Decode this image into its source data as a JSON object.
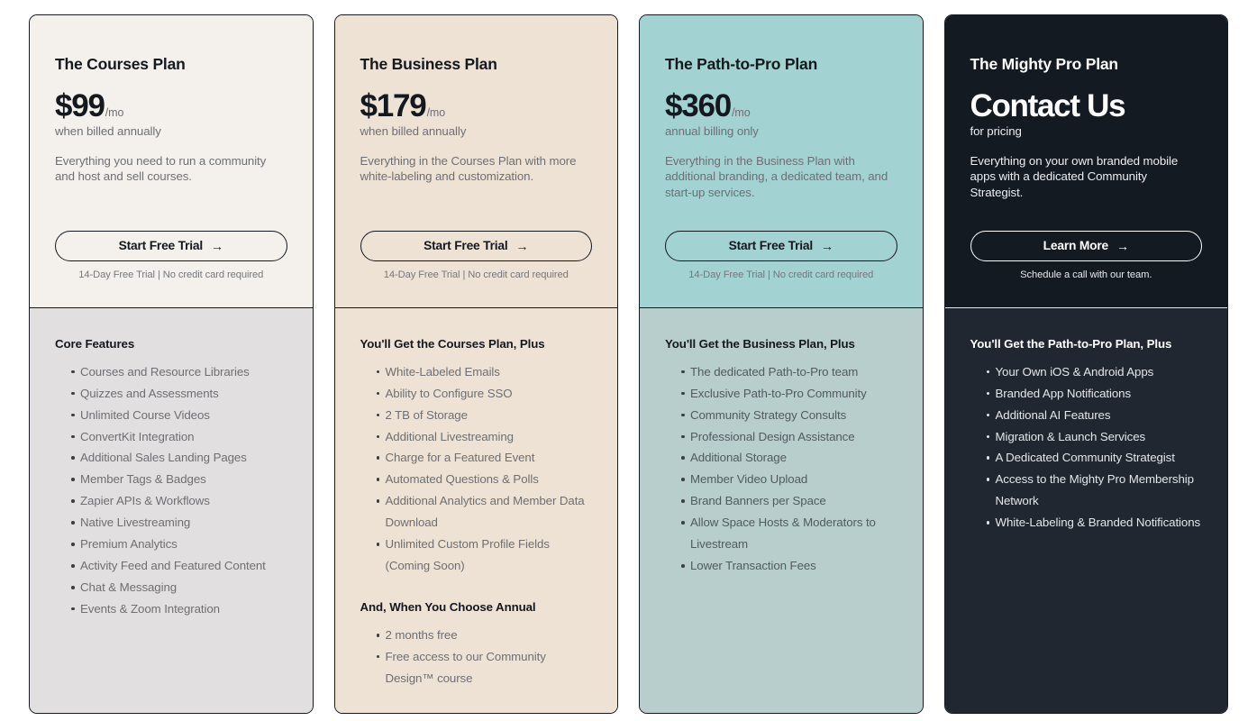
{
  "page": {
    "background": "#ffffff",
    "accent_teal": "#a2d2d2",
    "accent_cream": "#eee2d5",
    "accent_dark": "#141a22"
  },
  "plans": [
    {
      "name": "The Courses Plan",
      "price": "$99",
      "price_suffix": "/mo",
      "price_note": "when billed annually",
      "description": "Everything you need to run a community and host and sell courses.",
      "cta_label": "Start Free Trial",
      "cta_arrow": "→",
      "cta_sub": "14-Day Free Trial | No credit card required",
      "groups": [
        {
          "title": "Core Features",
          "items": [
            "Courses and Resource Libraries",
            "Quizzes and Assessments",
            "Unlimited Course Videos",
            "ConvertKit Integration",
            "Additional Sales Landing Pages",
            "Member Tags & Badges",
            "Zapier APIs & Workflows",
            "Native Livestreaming",
            "Premium Analytics",
            "Activity Feed and Featured Content",
            "Chat & Messaging",
            "Events & Zoom Integration"
          ]
        }
      ]
    },
    {
      "name": "The Business Plan",
      "price": "$179",
      "price_suffix": "/mo",
      "price_note": "when billed annually",
      "description": "Everything in the Courses Plan with more white-labeling and customization.",
      "cta_label": "Start Free Trial",
      "cta_arrow": "→",
      "cta_sub": "14-Day Free Trial | No credit card required",
      "groups": [
        {
          "title": "You'll Get the Courses Plan, Plus",
          "items": [
            "White-Labeled Emails",
            "Ability to Configure SSO",
            "2 TB of Storage",
            "Additional Livestreaming",
            "Charge for a Featured Event",
            "Automated Questions & Polls",
            "Additional Analytics and Member Data Download",
            "Unlimited Custom Profile Fields (Coming Soon)"
          ]
        },
        {
          "title": "And, When You Choose Annual",
          "items": [
            "2 months free",
            "Free access to our Community Design™ course"
          ]
        }
      ]
    },
    {
      "name": "The Path-to-Pro Plan",
      "price": "$360",
      "price_suffix": "/mo",
      "price_note": "annual billing only",
      "description": "Everything in the Business Plan with additional branding, a dedicated team, and start-up services.",
      "cta_label": "Start Free Trial",
      "cta_arrow": "→",
      "cta_sub": "14-Day Free Trial | No credit card required",
      "groups": [
        {
          "title": "You'll Get the Business Plan, Plus",
          "items": [
            "The dedicated Path-to-Pro team",
            "Exclusive Path-to-Pro Community",
            "Community Strategy Consults",
            "Professional Design Assistance",
            "Additional Storage",
            "Member Video Upload",
            "Brand Banners per Space",
            "Allow Space Hosts & Moderators to Livestream",
            "Lower Transaction Fees"
          ]
        }
      ]
    },
    {
      "name": "The Mighty Pro Plan",
      "price": "Contact Us",
      "price_suffix": "",
      "price_note": "for pricing",
      "description": "Everything on your own branded mobile apps with a dedicated Community Strategist.",
      "cta_label": "Learn More",
      "cta_arrow": "→",
      "cta_sub": "Schedule a call with our team.",
      "groups": [
        {
          "title": "You'll Get the Path-to-Pro Plan, Plus",
          "items": [
            "Your Own iOS & Android Apps",
            "Branded App Notifications",
            "Additional AI Features",
            "Migration & Launch Services",
            "A Dedicated Community Strategist",
            "Access to the Mighty Pro Membership Network",
            "White-Labeling & Branded Notifications"
          ]
        }
      ]
    }
  ]
}
